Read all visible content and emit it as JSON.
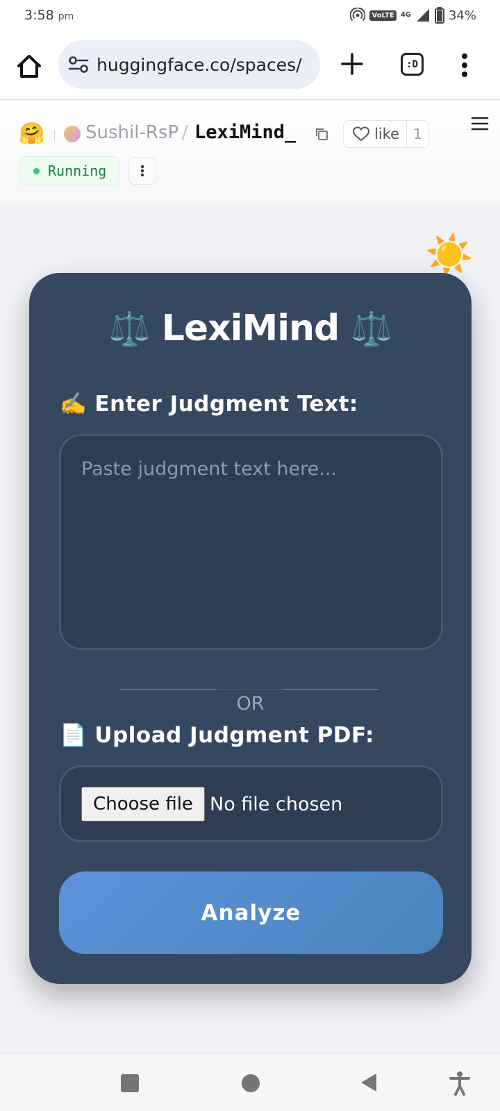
{
  "status_bar": {
    "time": "3:58",
    "ampm": "pm",
    "network_volte": "VoLTE",
    "network_4g": "4G",
    "battery": "34%"
  },
  "browser": {
    "url": "huggingface.co/spaces/",
    "tab_icon_label": ":D"
  },
  "hf_header": {
    "logo_emoji": "🤗",
    "owner": "Sushil-RsP",
    "separator": "/",
    "repo": "LexiMind_",
    "like_label": "like",
    "like_count": "1",
    "status": "Running"
  },
  "app": {
    "theme_toggle_emoji": "☀️",
    "title": "LexiMind",
    "title_emoji": "⚖️",
    "text_label_emoji": "✍️",
    "text_label": "Enter Judgment Text:",
    "text_placeholder": "Paste judgment text here...",
    "or_text": "OR",
    "upload_label_emoji": "📄",
    "upload_label": "Upload Judgment PDF:",
    "choose_file": "Choose file",
    "no_file": "No file chosen",
    "analyze": "Analyze"
  },
  "colors": {
    "card_bg": "#354860",
    "input_bg": "#2e3d51",
    "button_gradient_start": "#5d93db",
    "button_gradient_end": "#4a84bd",
    "running_green": "#3cc47a"
  }
}
